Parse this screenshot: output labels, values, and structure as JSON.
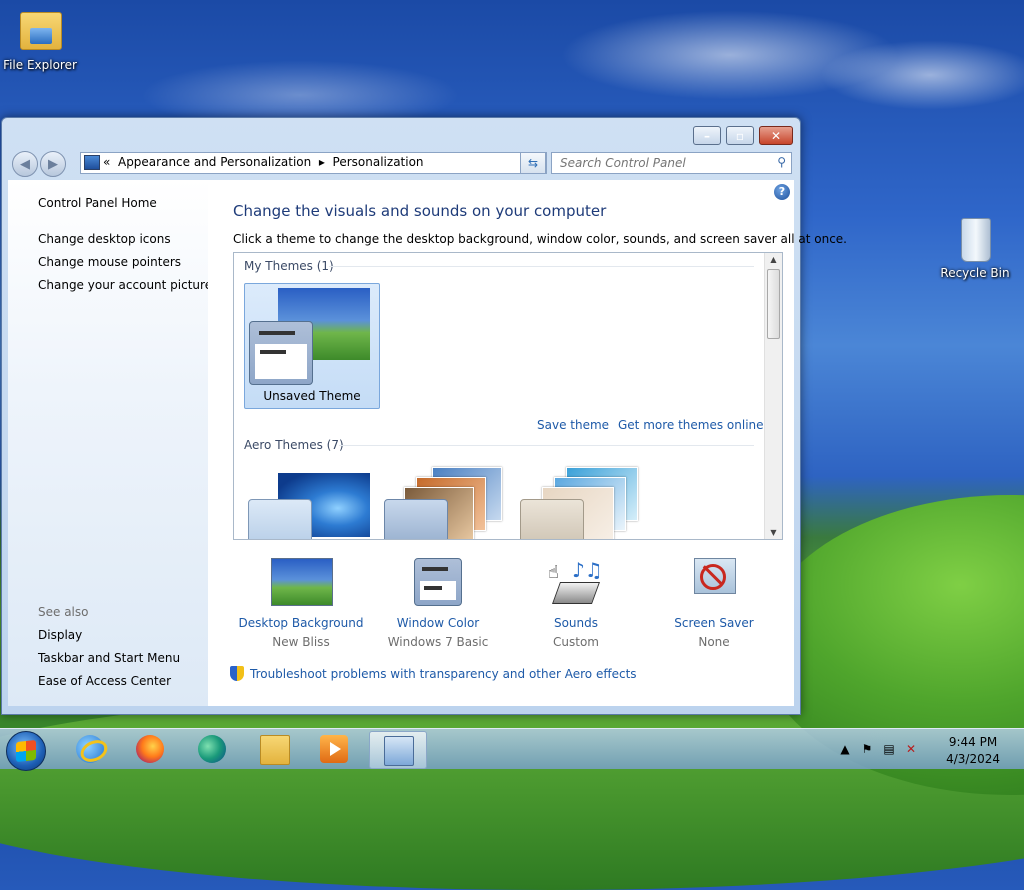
{
  "desktop": {
    "icons": [
      {
        "label": "File Explorer"
      },
      {
        "label": "Recycle Bin"
      }
    ]
  },
  "window": {
    "address": {
      "prefix": "«",
      "crumb1": "Appearance and Personalization",
      "sep": "▸",
      "crumb2": "Personalization"
    },
    "search": {
      "placeholder": "Search Control Panel"
    },
    "sidebar": {
      "home": "Control Panel Home",
      "links": [
        "Change desktop icons",
        "Change mouse pointers",
        "Change your account picture"
      ],
      "see_also_heading": "See also",
      "see_also": [
        "Display",
        "Taskbar and Start Menu",
        "Ease of Access Center"
      ]
    },
    "main": {
      "heading": "Change the visuals and sounds on your computer",
      "subtext": "Click a theme to change the desktop background, window color, sounds, and screen saver all at once.",
      "my_themes_label": "My Themes (1)",
      "unsaved_theme": "Unsaved Theme",
      "save_theme": "Save theme",
      "get_more": "Get more themes online",
      "aero_label": "Aero Themes (7)",
      "bottom": [
        {
          "label": "Desktop Background",
          "value": "New Bliss"
        },
        {
          "label": "Window Color",
          "value": "Windows 7 Basic"
        },
        {
          "label": "Sounds",
          "value": "Custom"
        },
        {
          "label": "Screen Saver",
          "value": "None"
        }
      ],
      "troubleshoot": "Troubleshoot problems with transparency and other Aero effects"
    }
  },
  "taskbar": {
    "time": "9:44 PM",
    "date": "4/3/2024"
  },
  "colors": {
    "link": "#1e5aa8",
    "heading": "#1e3b79"
  }
}
